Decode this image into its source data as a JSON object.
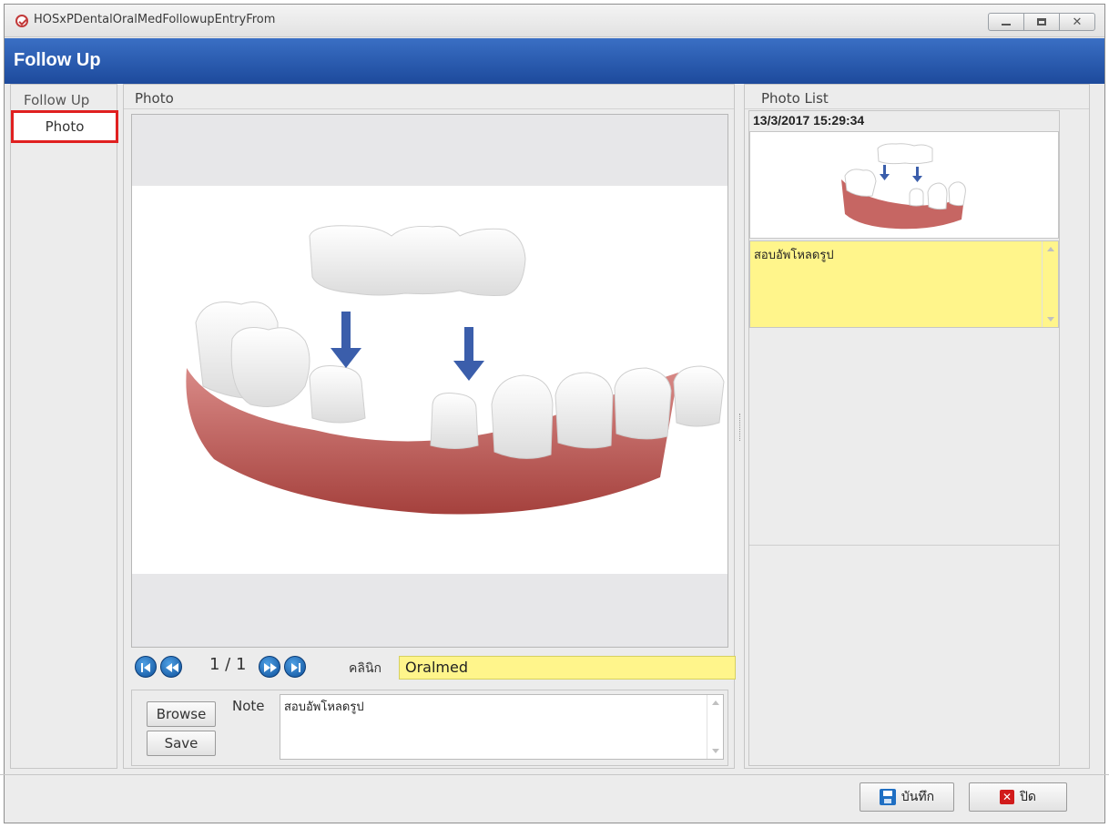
{
  "window": {
    "title": "HOSxPDentalOralMedFollowupEntryFrom",
    "header_title": "Follow Up"
  },
  "left_nav": {
    "heading": "Follow Up",
    "items": [
      {
        "label": "Photo",
        "selected": true
      }
    ]
  },
  "photo_panel": {
    "title": "Photo",
    "image_alt": "dental bridge illustration",
    "navigator": {
      "page_indicator": "1 / 1"
    },
    "clinic": {
      "label": "คลินิก",
      "value": "Oralmed"
    },
    "browse_label": "Browse",
    "save_label": "Save",
    "note": {
      "label": "Note",
      "value": "สอบอัพโหลดรูป"
    }
  },
  "photo_list": {
    "title": "Photo List",
    "items": [
      {
        "date": "13/3/2017 15:29:34",
        "note": "สอบอัพโหลดรูป"
      }
    ]
  },
  "footer": {
    "save_label": "บันทึก",
    "close_label": "ปิด"
  },
  "colors": {
    "header_blue": "#1d4a9c",
    "highlight_yellow": "#fff58b",
    "selected_border_red": "#e02020"
  }
}
